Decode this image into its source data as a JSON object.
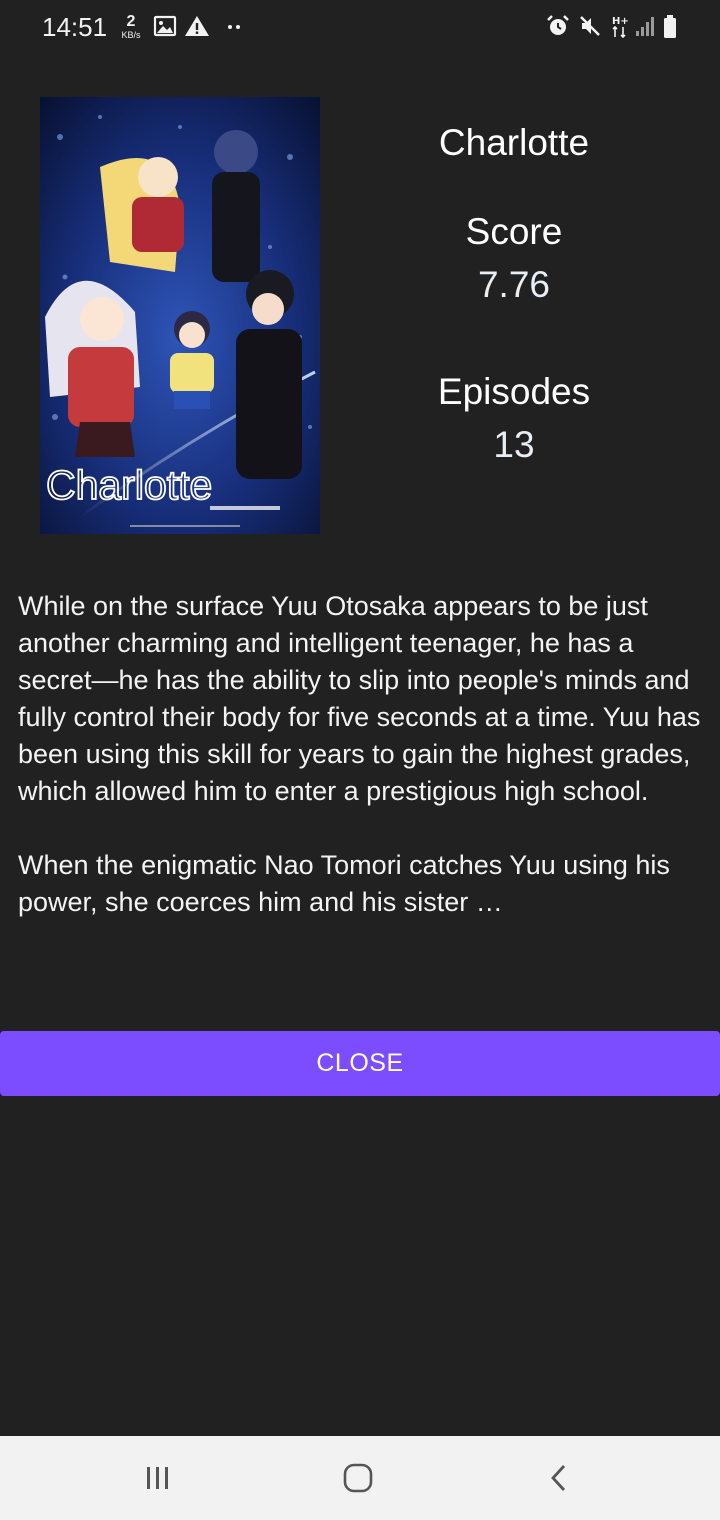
{
  "status_bar": {
    "time": "14:51",
    "network_speed_value": "2",
    "network_speed_unit": "KB/s",
    "icons": [
      "image-icon",
      "warning-icon",
      "more-dots-icon",
      "alarm-icon",
      "mute-icon",
      "hplus-data-icon",
      "signal-icon",
      "battery-icon"
    ]
  },
  "anime": {
    "title": "Charlotte",
    "score_label": "Score",
    "score_value": "7.76",
    "episodes_label": "Episodes",
    "episodes_value": "13",
    "poster_logo_text": "Charlotte",
    "synopsis": "While on the surface Yuu Otosaka appears to be just another charming and intelligent teenager, he has a secret—he has the ability to slip into people's minds and fully control their body for five seconds at a time. Yuu has been using this skill for years to gain the highest grades, which allowed him to enter a prestigious high school.\n\nWhen the enigmatic Nao Tomori catches Yuu using his power, she coerces him and his sister …"
  },
  "actions": {
    "close_label": "CLOSE"
  },
  "nav_bar": {
    "icons": [
      "recent-apps-icon",
      "home-icon",
      "back-icon"
    ]
  },
  "colors": {
    "background": "#212121",
    "accent": "#7c4dff",
    "nav_background": "#f2f2f2"
  }
}
